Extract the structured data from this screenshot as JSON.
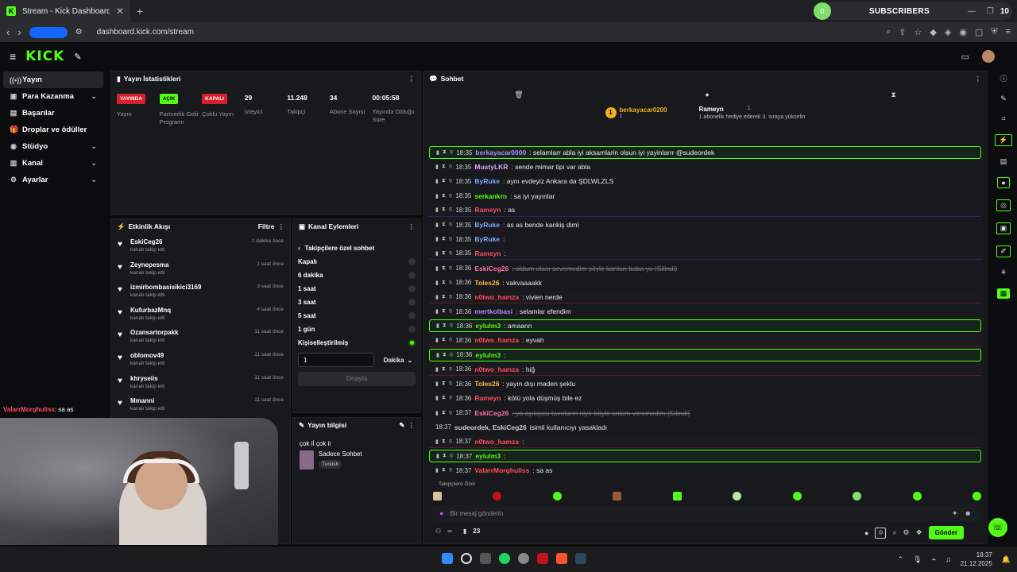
{
  "browser": {
    "tab_title": "Stream - Kick Dashboard",
    "tab_favicon": "K",
    "url": "dashboard.kick.com/stream",
    "subs_label": "SUBSCRIBERS",
    "subs_dot": "0",
    "subs_count": "10"
  },
  "header": {
    "logo": "KICK"
  },
  "sidebar": {
    "items": [
      {
        "label": "Yayın",
        "icon": "((•))"
      },
      {
        "label": "Para Kazanma",
        "icon": "▣",
        "chevron": "⌄"
      },
      {
        "label": "Başarılar",
        "icon": "▤"
      },
      {
        "label": "Droplar ve ödüller",
        "icon": "🎁"
      },
      {
        "label": "Stüdyo",
        "icon": "◉",
        "chevron": "⌄"
      },
      {
        "label": "Kanal",
        "icon": "▥",
        "chevron": "⌄"
      },
      {
        "label": "Ayarlar",
        "icon": "⚙",
        "chevron": "⌄"
      }
    ]
  },
  "stats_panel": {
    "title": "Yayın İstatistikleri",
    "badges": [
      {
        "text": "YAYINDA",
        "label": "Yayın"
      },
      {
        "text": "AÇIK",
        "label": "Partnerlik Gelir Programı"
      },
      {
        "text": "KAPALI",
        "label": "Çoklu Yayın"
      }
    ],
    "numbers": [
      {
        "value": "29",
        "label": "İzleyici"
      },
      {
        "value": "11.248",
        "label": "Takipçi"
      },
      {
        "value": "34",
        "label": "Abone Sayısı"
      },
      {
        "value": "00:05:58",
        "label": "Yayında Olduğu Süre"
      }
    ]
  },
  "activity": {
    "title": "Etkinlik Akışı",
    "filter": "Filtre",
    "items": [
      {
        "name": "EskiCeg26",
        "sub": "kanalı takip etti",
        "time": "1 dakika önce"
      },
      {
        "name": "Zeynepesma",
        "sub": "kanalı takip etti",
        "time": "1 saat önce"
      },
      {
        "name": "izmirbombasisikici3169",
        "sub": "kanalı takip etti",
        "time": "3 saat önce"
      },
      {
        "name": "KufurbazMnq",
        "sub": "kanalı takip etti",
        "time": "4 saat önce"
      },
      {
        "name": "Ozansartorpakk",
        "sub": "kanalı takip etti",
        "time": "11 saat önce"
      },
      {
        "name": "oblomov49",
        "sub": "kanalı takip etti",
        "time": "11 saat önce"
      },
      {
        "name": "khryseiis",
        "sub": "kanalı takip etti",
        "time": "11 saat önce"
      },
      {
        "name": "Mmanni",
        "sub": "kanalı takip etti",
        "time": "11 saat önce"
      }
    ]
  },
  "channel_actions": {
    "title": "Kanal Eylemleri",
    "back_label": "Takipçilere özel sohbet",
    "options": [
      "Kapalı",
      "6 dakika",
      "1 saat",
      "3 saat",
      "5 saat",
      "1 gün",
      "Kişiselleştirilmiş"
    ],
    "input_value": "1",
    "unit": "Dakika",
    "confirm": "Onayla"
  },
  "stream_info": {
    "title": "Yayın bilgisi",
    "stream_title": "çok iİ çok ii",
    "category": "Sadece Sohbet",
    "tag": "Turkish"
  },
  "chat": {
    "title": "Sohbet",
    "pinned": {
      "user1": "berkayacar0200",
      "count1": "1",
      "user2": "Rameyn",
      "count2": "1",
      "note": "1 abonelik hediye ederek 3. sıraya yükselin"
    },
    "messages": [
      {
        "time": "18:35",
        "user": "berkayacar0000",
        "color": "#a58cff",
        "text": ": selamlarr abla iyi aksamlarin olsun iyi yayinlarrr @sudeordek",
        "style": "hl-green"
      },
      {
        "time": "18:35",
        "user": "MustyLKR",
        "color": "#d9a3ff",
        "text": ": sende mimar tipi var abla",
        "style": ""
      },
      {
        "time": "18:35",
        "user": "ByRuke",
        "color": "#7aa7ff",
        "text": ": aynı evdeyiz Ankara da ŞDLWLZLS",
        "style": ""
      },
      {
        "time": "18:35",
        "user": "serkankrn",
        "color": "#53fc18",
        "text": ": sa iyi yayınlar",
        "style": ""
      },
      {
        "time": "18:35",
        "user": "Rameyn",
        "color": "#ff4b5c",
        "text": ": as",
        "style": "hl-blue"
      },
      {
        "time": "18:35",
        "user": "ByRuke",
        "color": "#7aa7ff",
        "text": ": as as bende kankiş dimi",
        "style": ""
      },
      {
        "time": "18:35",
        "user": "ByRuke",
        "color": "#7aa7ff",
        "text": ":",
        "style": ""
      },
      {
        "time": "18:35",
        "user": "Rameyn",
        "color": "#ff4b5c",
        "text": ":",
        "style": "hl-blue"
      },
      {
        "time": "18:36",
        "user": "EskiCeg26",
        "color": "#ff6ea8",
        "text": ": oldum olası sevemedim şöyle karıları baba ya (Silindi)",
        "style": "del"
      },
      {
        "time": "18:36",
        "user": "Toles26",
        "color": "#ffb84d",
        "text": ": vakvaaaakk",
        "style": ""
      },
      {
        "time": "18:36",
        "user": "n0two_hamza",
        "color": "#ff4b5c",
        "text": ": vivien nerde",
        "style": "hl-red"
      },
      {
        "time": "18:36",
        "user": "mertkolbasi",
        "color": "#a58cff",
        "text": ": selamlar efendim",
        "style": ""
      },
      {
        "time": "18:36",
        "user": "eylulm3",
        "color": "#53fc18",
        "text": ": amaann",
        "style": "hl-green"
      },
      {
        "time": "18:36",
        "user": "n0two_hamza",
        "color": "#ff4b5c",
        "text": ": eyvah",
        "style": "hl-red"
      },
      {
        "time": "18:36",
        "user": "eylulm3",
        "color": "#53fc18",
        "text": ":",
        "style": "hl-green"
      },
      {
        "time": "18:36",
        "user": "n0two_hamza",
        "color": "#ff4b5c",
        "text": ": hiğ",
        "style": "hl-red"
      },
      {
        "time": "18:36",
        "user": "Toles26",
        "color": "#ffb84d",
        "text": ": yayın dışı maden şeklu",
        "style": ""
      },
      {
        "time": "18:36",
        "user": "Rameyn",
        "color": "#ff4b5c",
        "text": ": kötü yola düşmüş bile ez",
        "style": ""
      },
      {
        "time": "18:37",
        "user": "EskiCeg26",
        "color": "#ff6ea8",
        "text": ": ya açıkçası tavırların niye böyle anlam veremedim (Silindi)",
        "style": "del"
      },
      {
        "time": "18:37",
        "user": "sudeordek, EskiCeg26",
        "color": "#cfcfcf",
        "text": " isimli kullanıcıyı yasakladı",
        "style": "sys"
      },
      {
        "time": "18:37",
        "user": "n0two_hamza",
        "color": "#ff4b5c",
        "text": ":",
        "style": "hl-red"
      },
      {
        "time": "18:37",
        "user": "eylulm3",
        "color": "#53fc18",
        "text": ":",
        "style": "hl-green"
      },
      {
        "time": "18:37",
        "user": "ValarrMorghuliss",
        "color": "#ff4b5c",
        "text": ": sa as",
        "style": ""
      }
    ],
    "followers_only": "Takipçilere Özel",
    "input_placeholder": "Bir mesaj gönderin",
    "viewer_count": "23",
    "send_label": "Gönder"
  },
  "overlay_chat": {
    "user": "ValarrMorghuliss",
    "text": ": sa as"
  },
  "taskbar": {
    "time": "18:37",
    "date": "21.12.2025"
  }
}
